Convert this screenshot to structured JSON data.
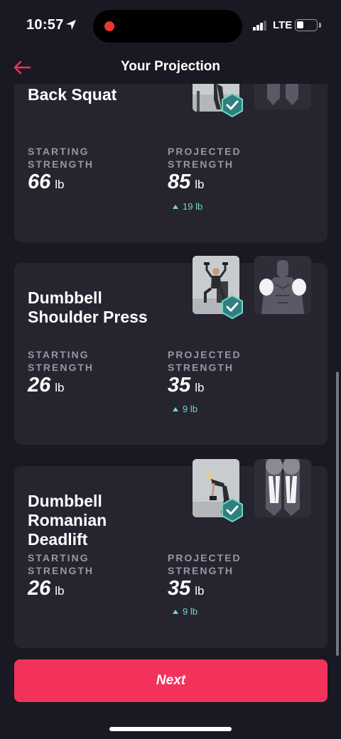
{
  "status_bar": {
    "time": "10:57",
    "network": "LTE"
  },
  "header": {
    "title": "Your Projection",
    "back_icon": "arrow-left-icon",
    "accent": "#f2325a"
  },
  "exercises": [
    {
      "name": "Back Squat",
      "starting_label": "STARTING STRENGTH",
      "starting_value": "66",
      "projected_label": "PROJECTED STRENGTH",
      "projected_value": "85",
      "unit": "lb",
      "increase": "19 lb"
    },
    {
      "name": "Dumbbell Shoulder Press",
      "starting_label": "STARTING STRENGTH",
      "starting_value": "26",
      "projected_label": "PROJECTED STRENGTH",
      "projected_value": "35",
      "unit": "lb",
      "increase": "9 lb"
    },
    {
      "name": "Dumbbell Romanian Deadlift",
      "starting_label": "STARTING STRENGTH",
      "starting_value": "26",
      "projected_label": "PROJECTED STRENGTH",
      "projected_value": "35",
      "unit": "lb",
      "increase": "9 lb"
    }
  ],
  "next_button": {
    "label": "Next"
  },
  "colors": {
    "background": "#1a1923",
    "card": "#25242f",
    "increase": "#6fd8c6",
    "badge": "#2f7f80"
  }
}
